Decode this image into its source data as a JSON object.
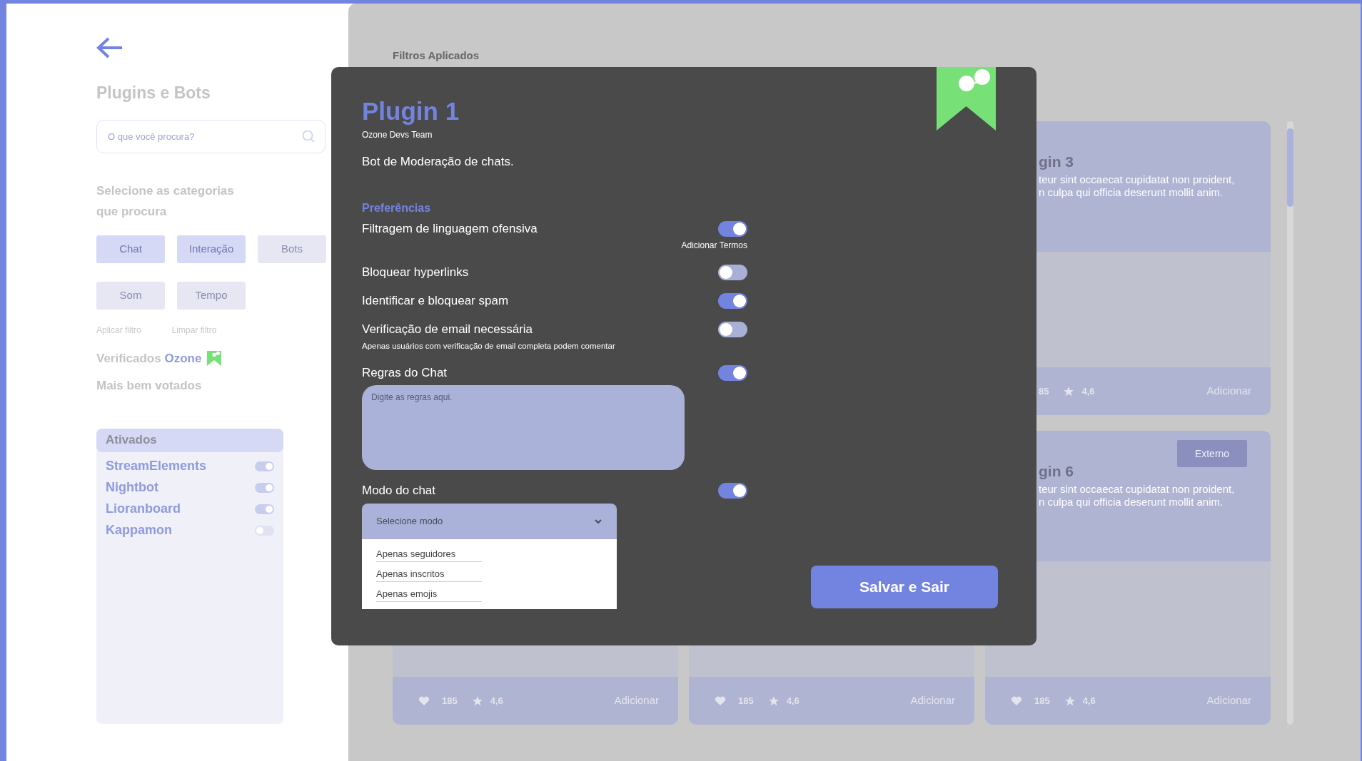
{
  "sidebar": {
    "title": "Plugins e Bots",
    "search": {
      "placeholder": "O que você procura?"
    },
    "categories_heading": "Selecione as categorias que procura",
    "categories": [
      {
        "label": "Chat",
        "selected": true
      },
      {
        "label": "Interação",
        "selected": true
      },
      {
        "label": "Bots",
        "selected": false
      },
      {
        "label": "Som",
        "selected": false
      },
      {
        "label": "Tempo",
        "selected": false
      }
    ],
    "filter_actions": [
      "Aplicar filtro",
      "Limpar filtro"
    ],
    "verified": {
      "label": "Verificados",
      "brand": "Ozone"
    },
    "top_voted": "Mais bem votados",
    "active_panel": {
      "title": "Ativados",
      "items": [
        {
          "name": "StreamElements",
          "on": true
        },
        {
          "name": "Nightbot",
          "on": true
        },
        {
          "name": "Lioranboard",
          "on": true
        },
        {
          "name": "Kappamon",
          "on": false
        }
      ]
    }
  },
  "main": {
    "filters_label": "Filtros Aplicados",
    "cards": [
      {
        "kind": "clipped",
        "title": "gin 3",
        "description_lines": [
          "teur sint occaecat cupidatat non proident,",
          "n culpa qui officia deserunt mollit anim."
        ],
        "footer": {
          "kind": "clipped",
          "likes": "85",
          "rating": "4,6",
          "action": "Adicionar"
        }
      },
      {
        "kind": "full",
        "footer": {
          "kind": "full",
          "likes": "185",
          "rating": "4,6",
          "action": "Adicionar"
        }
      },
      {
        "kind": "full",
        "footer": {
          "kind": "full",
          "likes": "185",
          "rating": "4,6",
          "action": "Adicionar"
        }
      },
      {
        "kind": "clipped",
        "badge": "Externo",
        "title": "gin 6",
        "description_lines": [
          "teur sint occaecat cupidatat non proident,",
          "n culpa qui officia deserunt mollit anim."
        ],
        "footer": {
          "kind": "full",
          "likes": "185",
          "rating": "4,6",
          "action": "Adicionar"
        }
      }
    ]
  },
  "modal": {
    "title": "Plugin 1",
    "author": "Ozone Devs Team",
    "description": "Bot de Moderação de chats.",
    "section": "Preferências",
    "preferences": [
      {
        "label": "Filtragem de linguagem ofensiva",
        "on": true,
        "link": "Adicionar Termos"
      },
      {
        "label": "Bloquear hyperlinks",
        "on": false
      },
      {
        "label": "Identificar e bloquear spam",
        "on": true
      },
      {
        "label": "Verificação de email necessária",
        "on": false,
        "note": "Apenas usuários com verificação de email completa podem comentar"
      },
      {
        "label": "Regras do Chat",
        "on": true,
        "textarea": {
          "placeholder": "Digite as regras aqui."
        }
      },
      {
        "label": "Modo do chat",
        "on": true,
        "select": {
          "value": "Selecione modo",
          "expanded": true,
          "options": [
            "Apenas seguidores",
            "Apenas inscritos",
            "Apenas emojis"
          ]
        }
      }
    ],
    "save_button": "Salvar e Sair"
  }
}
